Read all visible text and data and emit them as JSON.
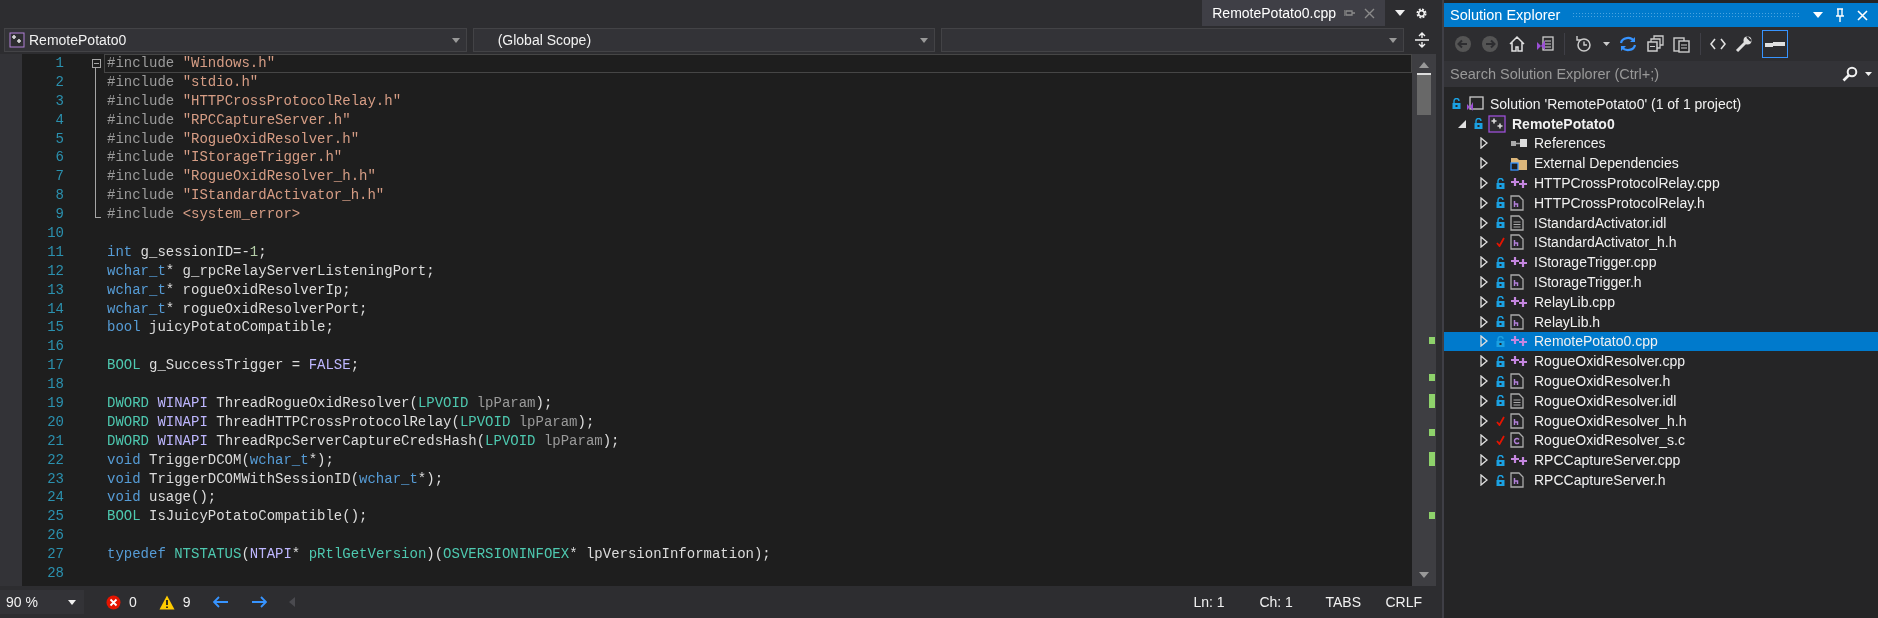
{
  "document_tabs": [
    {
      "label": "RemotePotato0.cpp",
      "selected": true
    }
  ],
  "navigation_bar": {
    "project": "RemotePotato0",
    "scope": "(Global Scope)"
  },
  "code_lines": [
    {
      "number": "1",
      "current": true,
      "fold_start": true,
      "fold_end": false,
      "tokens": [
        {
          "kind": "directive",
          "text": "#include "
        },
        {
          "kind": "string",
          "text": "\"Windows.h\""
        }
      ]
    },
    {
      "number": "2",
      "current": false,
      "fold_start": false,
      "fold_end": false,
      "tokens": [
        {
          "kind": "directive",
          "text": "#include "
        },
        {
          "kind": "string",
          "text": "\"stdio.h\""
        }
      ]
    },
    {
      "number": "3",
      "current": false,
      "fold_start": false,
      "fold_end": false,
      "tokens": [
        {
          "kind": "directive",
          "text": "#include "
        },
        {
          "kind": "string",
          "text": "\"HTTPCrossProtocolRelay.h\""
        }
      ]
    },
    {
      "number": "4",
      "current": false,
      "fold_start": false,
      "fold_end": false,
      "tokens": [
        {
          "kind": "directive",
          "text": "#include "
        },
        {
          "kind": "string",
          "text": "\"RPCCaptureServer.h\""
        }
      ]
    },
    {
      "number": "5",
      "current": false,
      "fold_start": false,
      "fold_end": false,
      "tokens": [
        {
          "kind": "directive",
          "text": "#include "
        },
        {
          "kind": "string",
          "text": "\"RogueOxidResolver.h\""
        }
      ]
    },
    {
      "number": "6",
      "current": false,
      "fold_start": false,
      "fold_end": false,
      "tokens": [
        {
          "kind": "directive",
          "text": "#include "
        },
        {
          "kind": "string",
          "text": "\"IStorageTrigger.h\""
        }
      ]
    },
    {
      "number": "7",
      "current": false,
      "fold_start": false,
      "fold_end": false,
      "tokens": [
        {
          "kind": "directive",
          "text": "#include "
        },
        {
          "kind": "string",
          "text": "\"RogueOxidResolver_h.h\""
        }
      ]
    },
    {
      "number": "8",
      "current": false,
      "fold_start": false,
      "fold_end": false,
      "tokens": [
        {
          "kind": "directive",
          "text": "#include "
        },
        {
          "kind": "string",
          "text": "\"IStandardActivator_h.h\""
        }
      ]
    },
    {
      "number": "9",
      "current": false,
      "fold_start": false,
      "fold_end": true,
      "tokens": [
        {
          "kind": "directive",
          "text": "#include "
        },
        {
          "kind": "string",
          "text": "<system_error>"
        }
      ]
    },
    {
      "number": "10",
      "current": false,
      "fold_start": false,
      "fold_end": false
    },
    {
      "number": "11",
      "current": false,
      "fold_start": false,
      "fold_end": false,
      "tokens": [
        {
          "kind": "keyword",
          "text": "int"
        },
        {
          "kind": "plain",
          "text": " g_sessionID=-"
        },
        {
          "kind": "number",
          "text": "1"
        },
        {
          "kind": "plain",
          "text": ";"
        }
      ]
    },
    {
      "number": "12",
      "current": false,
      "fold_start": false,
      "fold_end": false,
      "tokens": [
        {
          "kind": "keyword",
          "text": "wchar_t"
        },
        {
          "kind": "plain",
          "text": "* g_rpcRelayServerListeningPort;"
        }
      ]
    },
    {
      "number": "13",
      "current": false,
      "fold_start": false,
      "fold_end": false,
      "tokens": [
        {
          "kind": "keyword",
          "text": "wchar_t"
        },
        {
          "kind": "plain",
          "text": "* rogueOxidResolverIp;"
        }
      ]
    },
    {
      "number": "14",
      "current": false,
      "fold_start": false,
      "fold_end": false,
      "tokens": [
        {
          "kind": "keyword",
          "text": "wchar_t"
        },
        {
          "kind": "plain",
          "text": "* rogueOxidResolverPort;"
        }
      ]
    },
    {
      "number": "15",
      "current": false,
      "fold_start": false,
      "fold_end": false,
      "tokens": [
        {
          "kind": "keyword",
          "text": "bool"
        },
        {
          "kind": "plain",
          "text": " juicyPotatoCompatible;"
        }
      ]
    },
    {
      "number": "16",
      "current": false,
      "fold_start": false,
      "fold_end": false
    },
    {
      "number": "17",
      "current": false,
      "fold_start": false,
      "fold_end": false,
      "tokens": [
        {
          "kind": "type",
          "text": "BOOL"
        },
        {
          "kind": "plain",
          "text": " g_SuccessTrigger = "
        },
        {
          "kind": "macro",
          "text": "FALSE"
        },
        {
          "kind": "plain",
          "text": ";"
        }
      ]
    },
    {
      "number": "18",
      "current": false,
      "fold_start": false,
      "fold_end": false
    },
    {
      "number": "19",
      "current": false,
      "fold_start": false,
      "fold_end": false,
      "tokens": [
        {
          "kind": "type",
          "text": "DWORD"
        },
        {
          "kind": "macro",
          "text": " WINAPI"
        },
        {
          "kind": "plain",
          "text": " ThreadRogueOxidResolver("
        },
        {
          "kind": "type",
          "text": "LPVOID"
        },
        {
          "kind": "param",
          "text": " lpParam"
        },
        {
          "kind": "plain",
          "text": ");"
        }
      ]
    },
    {
      "number": "20",
      "current": false,
      "fold_start": false,
      "fold_end": false,
      "tokens": [
        {
          "kind": "type",
          "text": "DWORD"
        },
        {
          "kind": "macro",
          "text": " WINAPI"
        },
        {
          "kind": "plain",
          "text": " ThreadHTTPCrossProtocolRelay("
        },
        {
          "kind": "type",
          "text": "LPVOID"
        },
        {
          "kind": "param",
          "text": " lpParam"
        },
        {
          "kind": "plain",
          "text": ");"
        }
      ]
    },
    {
      "number": "21",
      "current": false,
      "fold_start": false,
      "fold_end": false,
      "tokens": [
        {
          "kind": "type",
          "text": "DWORD"
        },
        {
          "kind": "macro",
          "text": " WINAPI"
        },
        {
          "kind": "plain",
          "text": " ThreadRpcServerCaptureCredsHash("
        },
        {
          "kind": "type",
          "text": "LPVOID"
        },
        {
          "kind": "param",
          "text": " lpParam"
        },
        {
          "kind": "plain",
          "text": ");"
        }
      ]
    },
    {
      "number": "22",
      "current": false,
      "fold_start": false,
      "fold_end": false,
      "tokens": [
        {
          "kind": "keyword",
          "text": "void"
        },
        {
          "kind": "plain",
          "text": " TriggerDCOM("
        },
        {
          "kind": "keyword",
          "text": "wchar_t"
        },
        {
          "kind": "plain",
          "text": "*);"
        }
      ]
    },
    {
      "number": "23",
      "current": false,
      "fold_start": false,
      "fold_end": false,
      "tokens": [
        {
          "kind": "keyword",
          "text": "void"
        },
        {
          "kind": "plain",
          "text": " TriggerDCOMWithSessionID("
        },
        {
          "kind": "keyword",
          "text": "wchar_t"
        },
        {
          "kind": "plain",
          "text": "*);"
        }
      ]
    },
    {
      "number": "24",
      "current": false,
      "fold_start": false,
      "fold_end": false,
      "tokens": [
        {
          "kind": "keyword",
          "text": "void"
        },
        {
          "kind": "plain",
          "text": " usage();"
        }
      ]
    },
    {
      "number": "25",
      "current": false,
      "fold_start": false,
      "fold_end": false,
      "tokens": [
        {
          "kind": "type",
          "text": "BOOL"
        },
        {
          "kind": "plain",
          "text": " IsJuicyPotatoCompatible();"
        }
      ]
    },
    {
      "number": "26",
      "current": false,
      "fold_start": false,
      "fold_end": false
    },
    {
      "number": "27",
      "current": false,
      "fold_start": false,
      "fold_end": false,
      "tokens": [
        {
          "kind": "keyword",
          "text": "typedef"
        },
        {
          "kind": "type",
          "text": " NTSTATUS"
        },
        {
          "kind": "plain",
          "text": "("
        },
        {
          "kind": "macro",
          "text": "NTAPI"
        },
        {
          "kind": "plain",
          "text": "* "
        },
        {
          "kind": "type",
          "text": "pRtlGetVersion"
        },
        {
          "kind": "plain",
          "text": ")("
        },
        {
          "kind": "type",
          "text": "OSVERSIONINFOEX"
        },
        {
          "kind": "plain",
          "text": "* lpVersionInformation);"
        }
      ]
    },
    {
      "number": "28",
      "current": false,
      "fold_start": false,
      "fold_end": false
    }
  ],
  "status_bar": {
    "zoom": "90 %",
    "errors": "0",
    "warnings": "9",
    "line": "Ln: 1",
    "column": "Ch: 1",
    "indent": "TABS",
    "line_ending": "CRLF"
  },
  "solution_explorer": {
    "title": "Solution Explorer",
    "preview_toggle": {
      "on": true
    },
    "search": {
      "placeholder": "Search Solution Explorer (Ctrl+;)"
    },
    "tree": [
      {
        "kind": "solution",
        "label": "Solution 'RemotePotato0' (1 of 1 project)",
        "locked": true,
        "checked_out": false,
        "selected": false,
        "children": [
          {
            "kind": "project",
            "label": "RemotePotato0",
            "locked": true,
            "checked_out": false,
            "expanded": true,
            "selected": false,
            "children": [
              {
                "kind": "references",
                "label": "References",
                "locked": false,
                "checked_out": false,
                "expanded": false,
                "selected": false
              },
              {
                "kind": "folder",
                "label": "External Dependencies",
                "locked": false,
                "checked_out": false,
                "expanded": false,
                "selected": false
              },
              {
                "kind": "cpp",
                "label": "HTTPCrossProtocolRelay.cpp",
                "locked": true,
                "checked_out": false,
                "expanded": false,
                "selected": false
              },
              {
                "kind": "h",
                "label": "HTTPCrossProtocolRelay.h",
                "locked": true,
                "checked_out": false,
                "expanded": false,
                "selected": false
              },
              {
                "kind": "idl",
                "label": "IStandardActivator.idl",
                "locked": true,
                "checked_out": false,
                "expanded": false,
                "selected": false
              },
              {
                "kind": "h",
                "label": "IStandardActivator_h.h",
                "locked": false,
                "checked_out": true,
                "expanded": false,
                "selected": false
              },
              {
                "kind": "cpp",
                "label": "IStorageTrigger.cpp",
                "locked": true,
                "checked_out": false,
                "expanded": false,
                "selected": false
              },
              {
                "kind": "h",
                "label": "IStorageTrigger.h",
                "locked": true,
                "checked_out": false,
                "expanded": false,
                "selected": false
              },
              {
                "kind": "cpp",
                "label": "RelayLib.cpp",
                "locked": true,
                "checked_out": false,
                "expanded": false,
                "selected": false
              },
              {
                "kind": "h",
                "label": "RelayLib.h",
                "locked": true,
                "checked_out": false,
                "expanded": false,
                "selected": false
              },
              {
                "kind": "cpp",
                "label": "RemotePotato0.cpp",
                "locked": true,
                "checked_out": false,
                "expanded": false,
                "selected": true
              },
              {
                "kind": "cpp",
                "label": "RogueOxidResolver.cpp",
                "locked": true,
                "checked_out": false,
                "expanded": false,
                "selected": false
              },
              {
                "kind": "h",
                "label": "RogueOxidResolver.h",
                "locked": true,
                "checked_out": false,
                "expanded": false,
                "selected": false
              },
              {
                "kind": "idl",
                "label": "RogueOxidResolver.idl",
                "locked": true,
                "checked_out": false,
                "expanded": false,
                "selected": false
              },
              {
                "kind": "h",
                "label": "RogueOxidResolver_h.h",
                "locked": false,
                "checked_out": true,
                "expanded": false,
                "selected": false
              },
              {
                "kind": "c",
                "label": "RogueOxidResolver_s.c",
                "locked": false,
                "checked_out": true,
                "expanded": false,
                "selected": false
              },
              {
                "kind": "cpp",
                "label": "RPCCaptureServer.cpp",
                "locked": true,
                "checked_out": false,
                "expanded": false,
                "selected": false
              },
              {
                "kind": "h",
                "label": "RPCCaptureServer.h",
                "locked": true,
                "checked_out": false,
                "expanded": false,
                "selected": false
              }
            ]
          }
        ]
      }
    ]
  }
}
